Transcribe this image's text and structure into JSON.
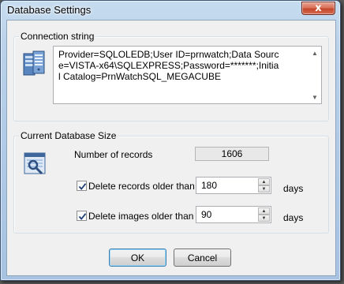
{
  "window": {
    "title": "Database Settings",
    "close_glyph": "x"
  },
  "connection": {
    "group_label": "Connection string",
    "value": "Provider=SQLOLEDB;User ID=prnwatch;Data Source=VISTA-x64\\SQLEXPRESS;Password=*******;Initial Catalog=PrnWatchSQL_MEGACUBE",
    "icon": "server-icon"
  },
  "size": {
    "group_label": "Current Database Size",
    "icon": "database-settings-icon",
    "records_label": "Number of records",
    "records_value": "1606",
    "delete_records": {
      "label": "Delete records older than",
      "checked": true,
      "value": "180",
      "unit": "days"
    },
    "delete_images": {
      "label": "Delete images older than",
      "checked": true,
      "value": "90",
      "unit": "days"
    }
  },
  "buttons": {
    "ok": "OK",
    "cancel": "Cancel"
  },
  "colors": {
    "accent": "#3c7fb1",
    "close": "#c4482c"
  }
}
